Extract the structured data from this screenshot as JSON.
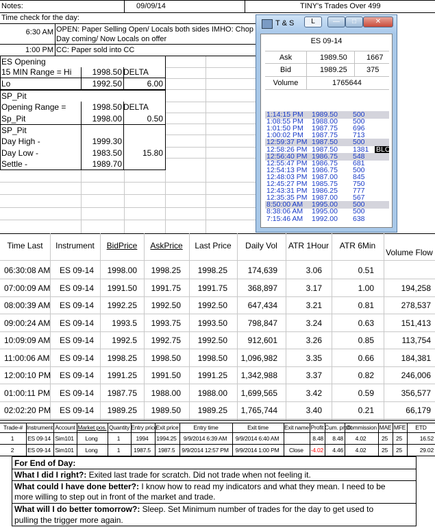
{
  "header": {
    "notes_label": "Notes:",
    "date": "09/09/14",
    "title": "TINY's Trades Over 499"
  },
  "time_check": "Time check for the day:",
  "notes": [
    {
      "time": "6:30 AM",
      "line1": "OPEN: Paper Selling Open/ Locals both sides IMHO: Chop",
      "line2": "Day coming/ Now Locals on offer"
    },
    {
      "time": "1:00 PM",
      "line1": "CC: Paper sold into CC",
      "line2": ""
    }
  ],
  "es_opening": {
    "title": "ES Opening",
    "range_label": "15 MIN Range = Hi",
    "hi": "1998.50",
    "delta_label": "DELTA",
    "lo_label": "Lo",
    "lo": "1992.50",
    "lo_delta": "6.00",
    "sp_pit": "SP_Pit",
    "opening_range_label": "Opening Range =",
    "or_hi": "1998.50",
    "or_delta_label": "DELTA",
    "sp_pit2": "Sp_Pit",
    "sp_pit_val": "1998.00",
    "sp_pit_delta": "0.50",
    "sp_pit3": "SP_Pit",
    "day_high_label": "Day High -",
    "day_high": "1999.30",
    "day_low_label": "Day Low -",
    "day_low": "1983.50",
    "day_delta": "15.80",
    "settle_label": "Settle -",
    "settle": "1989.70"
  },
  "ts": {
    "window_title": "T & S",
    "symbol": "ES 09-14",
    "ask_label": "Ask",
    "ask": "1989.50",
    "ask_size": "1667",
    "bid_label": "Bid",
    "bid": "1989.25",
    "bid_size": "375",
    "volume_label": "Volume",
    "volume": "1765644",
    "tape": [
      {
        "t": "1:14:15 PM",
        "p": "1989.50",
        "s": "500",
        "sel": true
      },
      {
        "t": "1:08:55 PM",
        "p": "1988.00",
        "s": "500"
      },
      {
        "t": "1:01:50 PM",
        "p": "1987.75",
        "s": "696"
      },
      {
        "t": "1:00:02 PM",
        "p": "1987.75",
        "s": "713"
      },
      {
        "t": "12:59:37 PM",
        "p": "1987.50",
        "s": "500",
        "sel": true
      },
      {
        "t": "12:58:26 PM",
        "p": "1987.50",
        "s": "1381",
        "tag": "BLO"
      },
      {
        "t": "12:56:40 PM",
        "p": "1986.75",
        "s": "548",
        "sel": true
      },
      {
        "t": "12:55:47 PM",
        "p": "1986.75",
        "s": "681"
      },
      {
        "t": "12:54:13 PM",
        "p": "1986.75",
        "s": "500"
      },
      {
        "t": "12:48:03 PM",
        "p": "1987.00",
        "s": "845"
      },
      {
        "t": "12:45:27 PM",
        "p": "1985.75",
        "s": "750"
      },
      {
        "t": "12:43:31 PM",
        "p": "1986.25",
        "s": "777"
      },
      {
        "t": "12:35:35 PM",
        "p": "1987.00",
        "s": "567"
      },
      {
        "t": "8:50:00 AM",
        "p": "1995.00",
        "s": "500",
        "sel": true
      },
      {
        "t": "8:38:06 AM",
        "p": "1995.00",
        "s": "500"
      },
      {
        "t": "7:15:46 AM",
        "p": "1992.00",
        "s": "638"
      }
    ]
  },
  "price_table": {
    "headers": [
      "Time Last",
      "Instrument",
      "BidPrice",
      "AskPrice",
      "Last Price",
      "Daily Vol",
      "ATR 1Hour",
      "ATR 6Min",
      "Volume Flow"
    ],
    "rows": [
      [
        "06:30:08 AM",
        "ES 09-14",
        "1998.00",
        "1998.25",
        "1998.25",
        "174,639",
        "3.06",
        "0.51",
        ""
      ],
      [
        "07:00:09 AM",
        "ES 09-14",
        "1991.50",
        "1991.75",
        "1991.75",
        "368,897",
        "3.17",
        "1.00",
        "194,258"
      ],
      [
        "08:00:39 AM",
        "ES 09-14",
        "1992.25",
        "1992.50",
        "1992.50",
        "647,434",
        "3.21",
        "0.81",
        "278,537"
      ],
      [
        "09:00:24 AM",
        "ES 09-14",
        "1993.5",
        "1993.75",
        "1993.50",
        "798,847",
        "3.24",
        "0.63",
        "151,413"
      ],
      [
        "10:09:09 AM",
        "ES 09-14",
        "1992.5",
        "1992.75",
        "1992.50",
        "912,601",
        "3.26",
        "0.85",
        "113,754"
      ],
      [
        "11:00:06 AM",
        "ES 09-14",
        "1998.25",
        "1998.50",
        "1998.50",
        "1,096,982",
        "3.35",
        "0.66",
        "184,381"
      ],
      [
        "12:00:10 PM",
        "ES 09-14",
        "1991.25",
        "1991.50",
        "1991.25",
        "1,342,988",
        "3.37",
        "0.82",
        "246,006"
      ],
      [
        "01:00:11 PM",
        "ES 09-14",
        "1987.75",
        "1988.00",
        "1988.00",
        "1,699,565",
        "3.42",
        "0.59",
        "356,577"
      ],
      [
        "02:02:20 PM",
        "ES 09-14",
        "1989.25",
        "1989.50",
        "1989.25",
        "1,765,744",
        "3.40",
        "0.21",
        "66,179"
      ]
    ]
  },
  "trade_table": {
    "headers": [
      "Trade-#",
      "Instrument",
      "Account",
      "Market pos.",
      "Quantity",
      "Entry price",
      "Exit price",
      "Entry time",
      "Exit time",
      "Exit name",
      "Profit",
      "Cum. profit",
      "Commission",
      "MAE",
      "MFE",
      "ETD"
    ],
    "rows": [
      [
        "1",
        "ES 09-14",
        "Sim101",
        "Long",
        "1",
        "1994",
        "1994.25",
        "9/9/2014 6:39 AM",
        "9/9/2014 6:40 AM",
        "",
        "8.48",
        "8.48",
        "4.02",
        "25",
        "25",
        "16.52"
      ],
      [
        "2",
        "ES 09-14",
        "Sim101",
        "Long",
        "1",
        "1987.5",
        "1987.5",
        "9/9/2014 12:57 PM",
        "9/9/2014 1:00 PM",
        "Close",
        "-4.02",
        "4.46",
        "4.02",
        "25",
        "25",
        "29.02"
      ]
    ],
    "negative_color": "#ff0000"
  },
  "eod": {
    "title": "For End of Day:",
    "q1": "What I did I right?:",
    "a1": "  Exited last trade for scratch.  Did not trade when not feeling it.",
    "q2": "What could I have done better?:",
    "a2": " I know how to read my indicators and what they mean.  I need to be",
    "a2b": "more willing to step out in front of the market and trade.",
    "q3": "What will I do better tomorrow?:",
    "a3": "  Sleep. Set Minimum number of trades for the day to get used to",
    "a3b": "pulling the trigger more again."
  }
}
